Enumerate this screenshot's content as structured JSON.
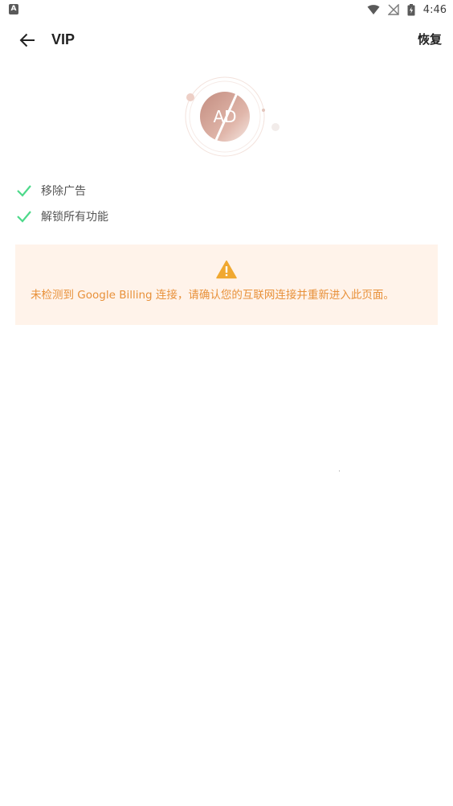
{
  "status_bar": {
    "left_icon_glyph": "A",
    "time": "4:46",
    "icons": [
      "wifi-icon",
      "no-signal-icon",
      "battery-icon"
    ]
  },
  "app_bar": {
    "back_icon": "arrow-left-icon",
    "title": "VIP",
    "restore_label": "恢复"
  },
  "logo": {
    "text": "AD",
    "icon": "ad-block-icon"
  },
  "features": [
    {
      "icon": "check-icon",
      "label": "移除广告"
    },
    {
      "icon": "check-icon",
      "label": "解锁所有功能"
    }
  ],
  "warning": {
    "icon": "warning-icon",
    "message": "未检测到 Google Billing 连接，请确认您的互联网连接并重新进入此页面。"
  },
  "colors": {
    "check": "#4dd98a",
    "warning_bg": "#fff3ea",
    "warning_text": "#e8913a",
    "warning_icon": "#f0a830",
    "logo_gradient_start": "#c9988a",
    "logo_gradient_end": "#f1ddd6"
  }
}
